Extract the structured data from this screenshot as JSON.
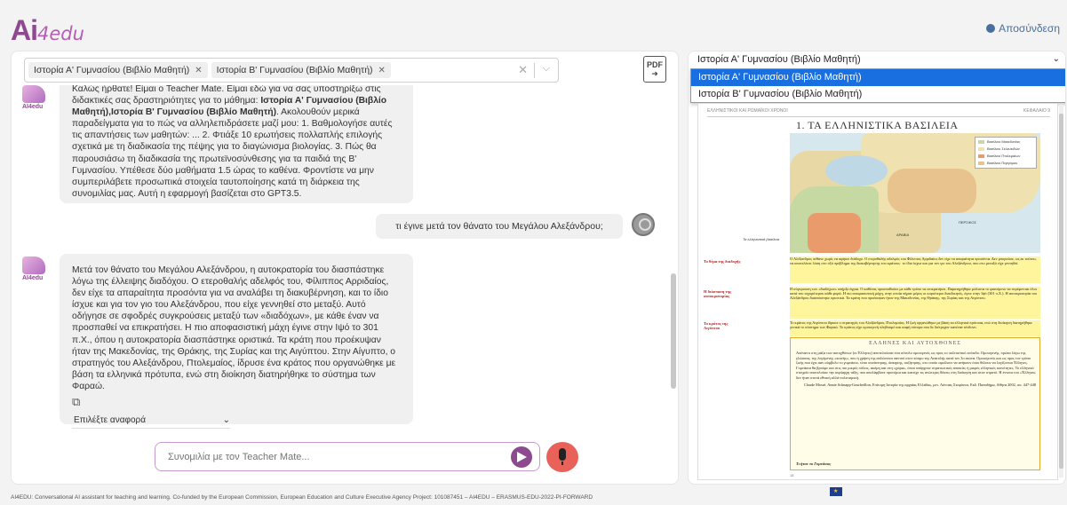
{
  "header": {
    "logo_main": "Ai",
    "logo_sub": "4edu",
    "logout_label": "Αποσύνδεση"
  },
  "chat": {
    "tags": [
      {
        "label": "Ιστορία Α' Γυμνασίου (Βιβλίο Μαθητή)"
      },
      {
        "label": "Ιστορία Β' Γυμνασίου (Βιβλίο Μαθητή)"
      }
    ],
    "pdf_label": "PDF",
    "intro_message": {
      "part1": "Καλώς ήρθατε! Είμαι ο Teacher Mate. Είμαι εδώ για να σας υποστηρίξω στις διδακτικές σας δραστηριότητες για το μάθημα: ",
      "bold": "Ιστορία Α' Γυμνασίου (Βιβλίο Μαθητή),Ιστορία Β' Γυμνασίου (Βιβλίο Μαθητή)",
      "part2": ". Ακολουθούν μερικά παραδείγματα για το πώς να αλληλεπιδράσετε μαζί μου: 1. Βαθμολογήσε αυτές τις απαντήσεις των μαθητών: ... 2. Φτιάξε 10 ερωτήσεις πολλαπλής επιλογής σχετικά με τη διαδικασία της πέψης για το διαγώνισμα βιολογίας. 3. Πώς θα παρουσιάσω τη διαδικασία της πρωτεϊνοσύνθεσης για τα παιδιά της Β' Γυμνασίου. Υπέθεσε δύο μαθήματα 1.5 ώρας το καθένα. Φροντίστε να μην συμπεριλάβετε προσωπικά στοιχεία ταυτοποίησης κατά τη διάρκεια της συνομιλίας μας. Αυτή η εφαρμογή βασίζεται στο GPT3.5."
    },
    "user_message": "τι έγινε μετά τον θάνατο του Μεγάλου Αλεξάνδρου;",
    "bot_answer": "Μετά τον θάνατο του Μεγάλου Αλεξάνδρου, η αυτοκρατορία του διασπάστηκε λόγω της έλλειψης διαδόχου. Ο ετεροθαλής αδελφός του, Φίλιππος Αρριδαίος, δεν είχε τα απαραίτητα προσόντα για να αναλάβει τη διακυβέρνηση, και το ίδιο ίσχυε και για τον γιο του Αλεξάνδρου, που είχε γεννηθεί στο μεταξύ. Αυτό οδήγησε σε σφοδρές συγκρούσεις μεταξύ των «διαδόχων», με κάθε έναν να προσπαθεί να επικρατήσει. Η πιο αποφασιστική μάχη έγινε στην Ιψό το 301 π.Χ., όπου η αυτοκρατορία διασπάστηκε οριστικά. Τα κράτη που προέκυψαν ήταν της Μακεδονίας, της Θράκης, της Συρίας και της Αιγύπτου. Στην Αίγυπτο, ο στρατηγός του Αλεξάνδρου, Πτολεμαίος, ίδρυσε ένα κράτος που οργανώθηκε με βάση τα ελληνικά πρότυπα, ενώ στη διοίκηση διατηρήθηκε το σύστημα των Φαραώ.",
    "reference_select": "Επιλέξτε αναφορά",
    "input_placeholder": "Συνομιλία με τον Teacher Mate...",
    "bot_avatar_label": "AI4edu"
  },
  "viewer": {
    "selected_book": "Ιστορία Α' Γυμνασίου (Βιβλίο Μαθητή)",
    "options": [
      "Ιστορία Α' Γυμνασίου (Βιβλίο Μαθητή)",
      "Ιστορία Β' Γυμνασίου (Βιβλίο Μαθητή)"
    ],
    "page": {
      "header_left": "ΕΛΛΗΝΙΣΤΙΚΟΙ ΚΑΙ ΡΩΜΑΪΚΟΙ ΧΡΟΝΟΙ",
      "header_right": "ΚΕΦΑΛΑΙΟ 9",
      "title": "1. ΤΑ ΕΛΛΗΝΙΣΤΙΚΑ ΒΑΣΙΛΕΙΑ",
      "map_caption": "Τα ελληνιστικά βασίλεια",
      "map_labels": [
        "ΑΡΑΒΙΑ",
        "ΠΕΡΣΙΚΟΣ"
      ],
      "legend": [
        "Βασίλειο Μακεδονίας",
        "Βασίλειο Σελευκιδών",
        "Βασίλειο Πτολεμαίων",
        "Βασίλειο Περγάμου"
      ],
      "side1": "Το θέμα της διαδοχής",
      "side2": "Η διάσπαση της αυτοκρατορίας",
      "side3": "Το κράτος της Αιγύπτου",
      "para1": "Ο Αλέξανδρος πέθανε χωρίς να αφήσει διάδοχο. Ο ετεροθαλής αδελφός του Φίλιππος Αρριδαίος δεν είχε τα απαραίτητα προσόντα. Δεν μπορούσε, ως εκ τούτου, να αποτελέσει λύση στο οξύ πρόβλημα της διακυβέρνησης του κράτους· το ίδιο ίσχυε και για τον γιο του Αλεξάνδρου, που στο μεταξύ είχε γεννηθεί.",
      "para2": "Η σύγκρουση των «διαδόχων» υπήρξε άγρια. Ο καθένας προσπαθούσε με κάθε τρόπο να επικρατήσει. Παρατηρήθηκε μάλιστα το φαινόμενο να στρέφονται όλοι κατά του ισχυρότερου κάθε φορά. Η πιο αποφασιστική μάχη, στην οποία πήραν μέρος οι κυριότεροι διεκδικητές, έγινε στην Ιψό (301 π.Χ.). Η αυτοκρατορία του Αλεξάνδρου διασπάστηκε οριστικά. Τα κράτη που προέκυψαν ήταν της Μακεδονίας, της Θράκης, της Συρίας και της Αιγύπτου.",
      "para3": "Το κράτος της Αιγύπτου ίδρυσε ο στρατηγός του Αλεξάνδρου, Πτολεμαίος. Η ζωή οργανώθηκε με βάση τα ελληνικά πρότυπα, ενώ στη διοίκηση διατηρήθηκε γενικά το σύστημα των Φαραώ. Το κράτος είχε ομοιογενή πληθυσμό και σαφή σύνορα που δε διέτρεχαν κανέναν κίνδυνο.",
      "box_title": "ΕΛΛΗΝΕΣ ΚΑΙ ΑΥΤΟΧΘΟΝΕΣ",
      "box_text": "Απέναντι στη μάζα των αυτοχθόνων (οι Έλληνες) αποτελούσαν ένα σύνολο ομοιογενές ως προς το πολιτιστικό επίπεδο. Ομοιογενής, πρώτα λόγω της γλώσσας, της λεγόμενης «κοινής», που η χρήση της απλώνεται παντού στον κόσμο της Ανατολής κατά τον 3ο αιώνα. Ομοιογενείς και ως προς τον τρόπο ζωής που έχει σαν σύμβολο το γυμνάσιο, τόπο συνάντησης, άσκησης, συζήτησης, στο οποίο οφείλουν να ανήκουν όσοι θέλουν να λογίζονται Έλληνες. Γυμνάσια θα βρούμε και στις πιο μικρές πόλεις, ακόμη και στη «χώρα», όπου υπάρχουν στρατιωτικές αποικίες ή μικρές ελληνικές κοινότητες. Το ελληνικό στοιχείο αποτελούσε την κυρίαρχη τάξη, που απολάμβανε προνόμια και κατείχε τις ανώτερες θέσεις στη διοίκηση και στον στρατό. Η έννοια του «Έλληνα» δεν ήταν στενά εθνική αλλά πολιτισμική.",
      "box_source": "Claude Mossé, Annie Schnapp-Gourbeillon, Επίτομη Ιστορία της αρχαίας Ελλάδας, μετ. Λύντιας Στεφάνου, Εκδ. Παπαδήμα, Αθήνα 2002, σσ. 447-448",
      "box_question": "Τι ήταν το Γυμνάσιο;",
      "page_number": "18"
    }
  },
  "footer": {
    "text": "AI4EDU: Conversational AI assistant for teaching and learning. Co-funded by the European Commission, European Education and Culture Executive Agency Project: 101087451 – AI4EDU – ERASMUS-EDU-2022-PI-FORWARD"
  }
}
